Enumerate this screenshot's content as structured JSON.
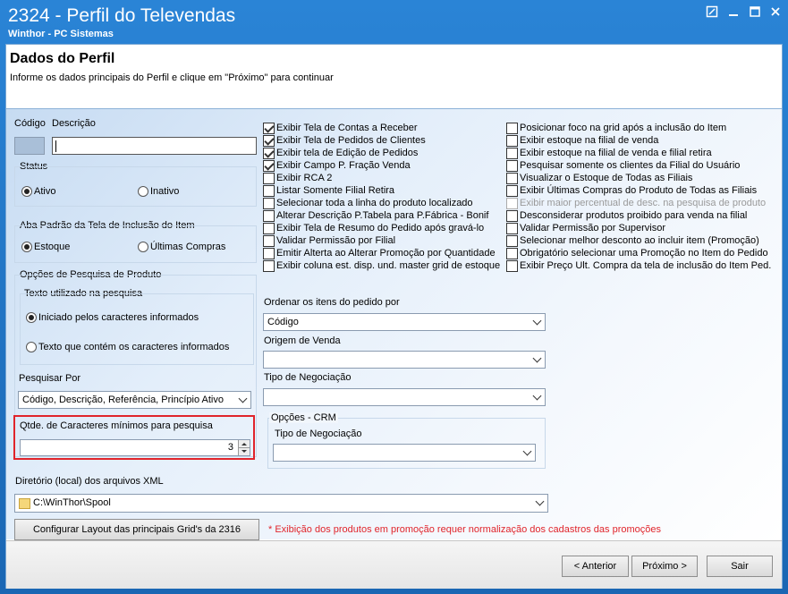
{
  "window": {
    "title": "2324 - Perfil do Televendas",
    "subtitle": "Winthor - PC Sistemas"
  },
  "header": {
    "title": "Dados do Perfil",
    "instructions": "Informe os dados principais do Perfil e clique em \"Próximo\" para continuar"
  },
  "profile": {
    "codigo_label": "Código",
    "descricao_label": "Descrição",
    "codigo_value": "",
    "descricao_value": ""
  },
  "status": {
    "label": "Status",
    "options": [
      "Ativo",
      "Inativo"
    ],
    "selected": "Ativo"
  },
  "aba_padrao": {
    "label": "Aba Padrão da Tela de Inclusão do Item",
    "options": [
      "Estoque",
      "Últimas Compras"
    ],
    "selected": "Estoque"
  },
  "opcoes_pesquisa": {
    "label": "Opções de Pesquisa de Produto",
    "texto_label": "Texto utilizado na pesquisa",
    "options": [
      "Iniciado pelos caracteres informados",
      "Texto que contém os caracteres informados"
    ],
    "selected": "Iniciado pelos caracteres informados"
  },
  "pesquisar_por": {
    "label": "Pesquisar Por",
    "value": "Código, Descrição, Referência, Princípio Ativo"
  },
  "qtde_caracteres": {
    "label": "Qtde. de Caracteres mínimos para pesquisa",
    "value": "3"
  },
  "checkboxes_left": [
    {
      "label": "Exibir Tela de Contas a Receber",
      "checked": true
    },
    {
      "label": "Exibir Tela de Pedidos de Clientes",
      "checked": true
    },
    {
      "label": "Exibir tela de Edição de Pedidos",
      "checked": true
    },
    {
      "label": "Exibir Campo P. Fração Venda",
      "checked": true
    },
    {
      "label": "Exibir RCA 2",
      "checked": false
    },
    {
      "label": "Listar Somente Filial Retira",
      "checked": false
    },
    {
      "label": "Selecionar toda a linha do produto localizado",
      "checked": false
    },
    {
      "label": "Alterar Descrição P.Tabela para P.Fábrica - Bonif",
      "checked": false
    },
    {
      "label": "Exibir Tela de Resumo do Pedido após gravá-lo",
      "checked": false
    },
    {
      "label": "Validar Permissão por Filial",
      "checked": false
    },
    {
      "label": "Emitir Alterta ao Alterar Promoção por Quantidade",
      "checked": false
    },
    {
      "label": "Exibir coluna est. disp. und. master grid de estoque",
      "checked": false
    }
  ],
  "checkboxes_right": [
    {
      "label": "Posicionar foco na grid após a inclusão do Item",
      "checked": false,
      "disabled": false
    },
    {
      "label": "Exibir estoque na filial de venda",
      "checked": false,
      "disabled": false
    },
    {
      "label": "Exibir estoque na filial de venda e filial retira",
      "checked": false,
      "disabled": false
    },
    {
      "label": "Pesquisar somente os clientes da Filial do Usuário",
      "checked": false,
      "disabled": false
    },
    {
      "label": "Visualizar o Estoque de Todas as Filiais",
      "checked": false,
      "disabled": false
    },
    {
      "label": "Exibir Últimas Compras do Produto de Todas as Filiais",
      "checked": false,
      "disabled": false
    },
    {
      "label": "Exibir maior percentual de desc. na pesquisa de produto",
      "checked": false,
      "disabled": true
    },
    {
      "label": "Desconsiderar produtos proibido para venda na filial",
      "checked": false,
      "disabled": false
    },
    {
      "label": "Validar Permissão por Supervisor",
      "checked": false,
      "disabled": false
    },
    {
      "label": "Selecionar melhor desconto ao incluir item (Promoção)",
      "checked": false,
      "disabled": false
    },
    {
      "label": "Obrigatório selecionar uma Promoção no Item do Pedido",
      "checked": false,
      "disabled": false
    },
    {
      "label": "Exibir Preço Ult. Compra da tela de inclusão do Item Ped.",
      "checked": false,
      "disabled": false
    }
  ],
  "ordenar": {
    "label": "Ordenar os itens do pedido por",
    "value": "Código"
  },
  "origem_venda": {
    "label": "Origem de Venda",
    "value": ""
  },
  "tipo_negociacao": {
    "label": "Tipo de Negociação",
    "value": ""
  },
  "opcoes_crm": {
    "label": "Opções - CRM",
    "tipo_label": "Tipo de Negociação",
    "value": ""
  },
  "diretorio": {
    "label": "Diretório (local) dos arquivos XML",
    "value": "C:\\WinThor\\Spool"
  },
  "configurar_button": "Configurar Layout das principais Grid's da 2316",
  "nota_promocao": "* Exibição dos produtos em promoção requer normalização dos cadastros das promoções",
  "footer": {
    "anterior_label": "< Anterior",
    "proximo_label": "Próximo >",
    "sair_label": "Sair"
  },
  "colors": {
    "title_bar": "#1f75c4",
    "highlight_border": "#e0242b",
    "note_text": "#e0242b"
  },
  "icons": [
    "restore-icon",
    "minimize-icon",
    "maximize-icon",
    "close-icon",
    "folder-icon",
    "chevron-down-icon"
  ]
}
